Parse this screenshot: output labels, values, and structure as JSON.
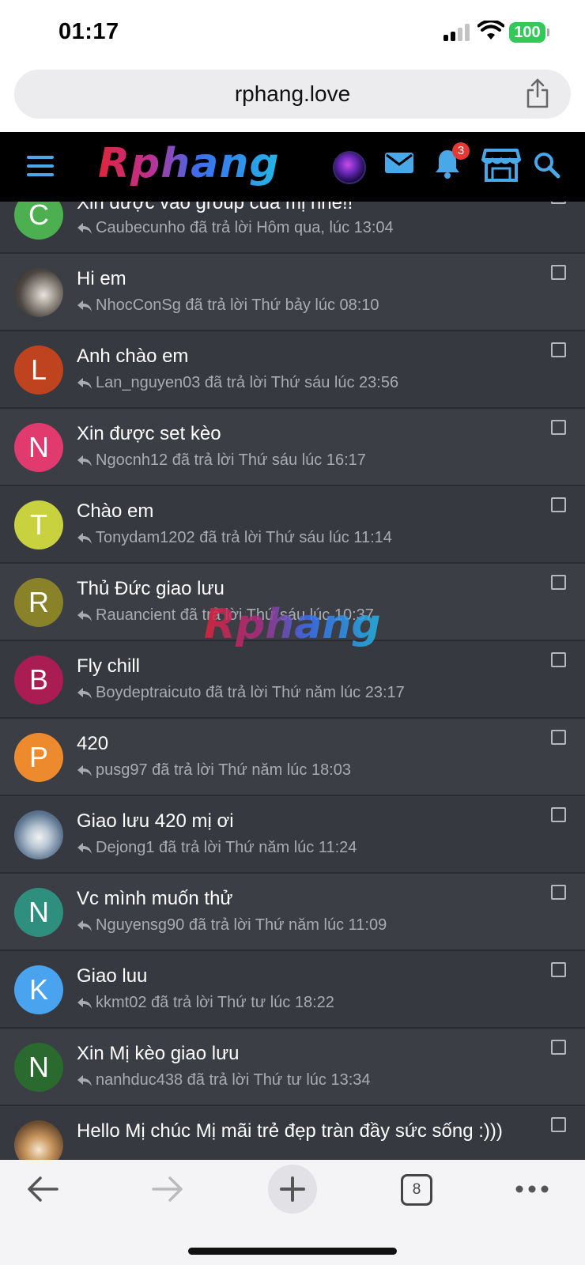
{
  "status_bar": {
    "time": "01:17",
    "battery": "100"
  },
  "browser": {
    "url": "rphang.love",
    "tab_count": "8"
  },
  "site": {
    "logo": "Rphang",
    "notification_count": "3",
    "watermark": "Rphang"
  },
  "threads": [
    {
      "title": "Xin được vào group của mị nhé!!",
      "meta": "Caubecunho đã trả lời Hôm qua, lúc 13:04",
      "letter": "C",
      "avatar_color": "#4caf50"
    },
    {
      "title": "Hi em",
      "meta": "NhocConSg đã trả lời Thứ bảy lúc 08:10",
      "letter": "",
      "avatar_color": "#6d6a66"
    },
    {
      "title": "Anh chào em",
      "meta": "Lan_nguyen03 đã trả lời Thứ sáu lúc 23:56",
      "letter": "L",
      "avatar_color": "#c0431f"
    },
    {
      "title": "Xin được set kèo",
      "meta": "Ngocnh12 đã trả lời Thứ sáu lúc 16:17",
      "letter": "N",
      "avatar_color": "#e03a6e"
    },
    {
      "title": "Chào em",
      "meta": "Tonydam1202 đã trả lời Thứ sáu lúc 11:14",
      "letter": "T",
      "avatar_color": "#c8d23e"
    },
    {
      "title": "Thủ Đức giao lưu",
      "meta": "Rauancient đã trả lời Thứ sáu lúc 10:37",
      "letter": "R",
      "avatar_color": "#8a8228"
    },
    {
      "title": "Fly chill",
      "meta": "Boydeptraicuto đã trả lời Thứ năm lúc 23:17",
      "letter": "B",
      "avatar_color": "#a91d52"
    },
    {
      "title": "420",
      "meta": "pusg97 đã trả lời Thứ năm lúc 18:03",
      "letter": "P",
      "avatar_color": "#ee8a2e"
    },
    {
      "title": "Giao lưu 420 mị ơi",
      "meta": "Dejong1 đã trả lời Thứ năm lúc 11:24",
      "letter": "",
      "avatar_color": "#8fa3b5"
    },
    {
      "title": "Vc mình muốn thử",
      "meta": "Nguyensg90 đã trả lời Thứ năm lúc 11:09",
      "letter": "N",
      "avatar_color": "#2e8f7f"
    },
    {
      "title": "Giao luu",
      "meta": "kkmt02 đã trả lời Thứ tư lúc 18:22",
      "letter": "K",
      "avatar_color": "#4aa3ee"
    },
    {
      "title": "Xin Mị kèo giao lưu",
      "meta": "nanhduc438 đã trả lời Thứ tư lúc 13:34",
      "letter": "N",
      "avatar_color": "#2b6a2e"
    },
    {
      "title": "Hello Mị chúc Mị mãi trẻ đẹp tràn đầy sức sống :)))",
      "meta": "",
      "letter": "",
      "avatar_color": "#b89060"
    }
  ]
}
